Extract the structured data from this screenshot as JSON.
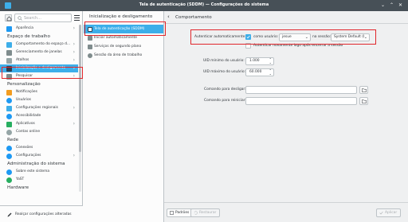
{
  "window": {
    "title": "Tela de autenticação (SDDM) — Configurações do sistema",
    "controls": [
      "⌄",
      "⌃",
      "✕"
    ]
  },
  "sidebar": {
    "search_placeholder": "Search...",
    "categories": [
      {
        "type": "item",
        "label": "Aparência",
        "icon": "appearance-icon",
        "color": "#1d99f3",
        "chevron": true
      },
      {
        "type": "cat",
        "label": "Espaço de trabalho"
      },
      {
        "type": "item",
        "label": "Comportamento do espaço d...",
        "icon": "workspace-behavior-icon",
        "color": "#3daee9",
        "chevron": true
      },
      {
        "type": "item",
        "label": "Gerenciamento de janelas",
        "icon": "window-management-icon",
        "color": "#7f8c8d",
        "chevron": true
      },
      {
        "type": "item",
        "label": "Atalhos",
        "icon": "shortcuts-icon",
        "color": "#95a5a6",
        "chevron": true
      },
      {
        "type": "item",
        "label": "Inicialização e desligamento",
        "icon": "startup-shutdown-icon",
        "color": "#2c3e50",
        "chevron": true,
        "active": true
      },
      {
        "type": "item",
        "label": "Pesquisar",
        "icon": "search-icon",
        "color": "#7f8c8d",
        "chevron": true
      },
      {
        "type": "cat",
        "label": "Personalização"
      },
      {
        "type": "item",
        "label": "Notificações",
        "icon": "notifications-icon",
        "color": "#f39c1f",
        "chevron": false
      },
      {
        "type": "item",
        "label": "Usuários",
        "icon": "users-icon",
        "color": "#1d99f3",
        "chevron": false,
        "round": true
      },
      {
        "type": "item",
        "label": "Configurações regionais",
        "icon": "regional-settings-icon",
        "color": "#3daee9",
        "chevron": true
      },
      {
        "type": "item",
        "label": "Acessibilidade",
        "icon": "accessibility-icon",
        "color": "#1d99f3",
        "chevron": false,
        "round": true
      },
      {
        "type": "item",
        "label": "Aplicativos",
        "icon": "applications-icon",
        "color": "#27ae60",
        "chevron": true
      },
      {
        "type": "item",
        "label": "Contas online",
        "icon": "online-accounts-icon",
        "color": "#95a5a6",
        "chevron": false,
        "round": true
      },
      {
        "type": "cat",
        "label": "Rede"
      },
      {
        "type": "item",
        "label": "Conexões",
        "icon": "connections-icon",
        "color": "#1d99f3",
        "chevron": false,
        "round": true
      },
      {
        "type": "item",
        "label": "Configurações",
        "icon": "network-settings-icon",
        "color": "#1d99f3",
        "chevron": true,
        "round": true
      },
      {
        "type": "cat",
        "label": "Administração do sistema"
      },
      {
        "type": "item",
        "label": "Sobre este sistema",
        "icon": "about-system-icon",
        "color": "#1d99f3",
        "chevron": false,
        "round": true
      },
      {
        "type": "item",
        "label": "YaST",
        "icon": "yast-icon",
        "color": "#27ae60",
        "chevron": false,
        "round": true
      },
      {
        "type": "cat",
        "label": "Hardware"
      }
    ],
    "footer_label": "Realçar configurações alteradas"
  },
  "midcol": {
    "title": "Inicialização e desligamento",
    "items": [
      {
        "label": "Tela de autenticação (SDDM)",
        "icon": "sddm-icon",
        "color": "#2c3e50",
        "active": true
      },
      {
        "label": "Iniciar automaticamente",
        "icon": "autostart-icon",
        "color": "#7f8c8d"
      },
      {
        "label": "Serviços de segundo plano",
        "icon": "background-services-icon",
        "color": "#7f8c8d"
      },
      {
        "label": "Sessão da área de trabalho",
        "icon": "desktop-session-icon",
        "color": "#7f8c8d",
        "round": true
      }
    ]
  },
  "main": {
    "title": "Comportamento",
    "autologin": {
      "label": "Autenticar automaticamente:",
      "checkbox_label": "como usuário:",
      "checked": true,
      "user": "jesue",
      "session_label": "na sessão:",
      "session": "System Default (I",
      "relogin_label": "Autenticar novamente logo após encerrar a sessão"
    },
    "uid_min": {
      "label": "UID mínimo do usuário:",
      "value": "1.000"
    },
    "uid_max": {
      "label": "UID máximo do usuário:",
      "value": "60.000"
    },
    "halt_cmd": {
      "label": "Comando para desligar:",
      "value": ""
    },
    "reboot_cmd": {
      "label": "Comando para reiniciar:",
      "value": ""
    },
    "buttons": {
      "defaults": "Padrões",
      "reset": "Restaurar",
      "apply": "Aplicar"
    }
  },
  "colors": {
    "accent": "#3daee9",
    "highlight": "#e0262b",
    "titlebar": "#475057"
  }
}
